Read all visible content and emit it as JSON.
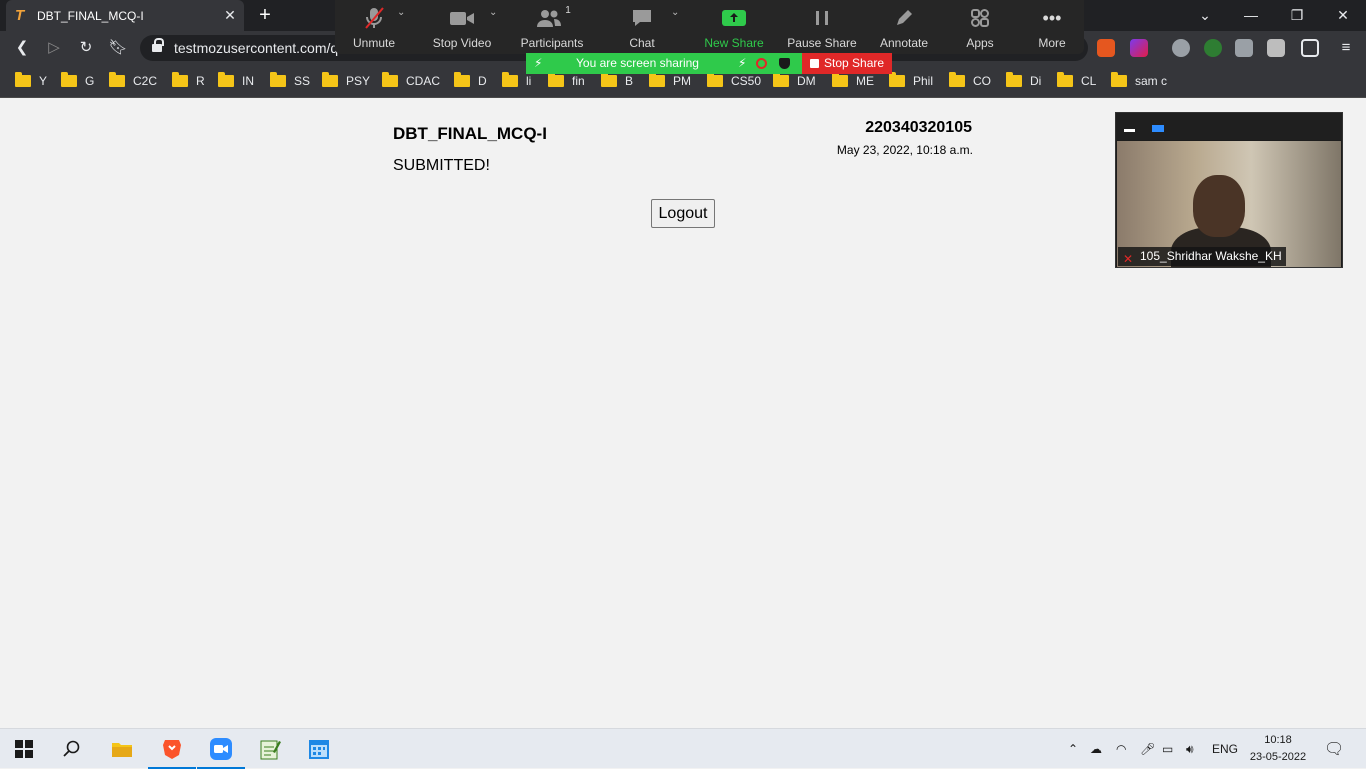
{
  "browser": {
    "tab_title": "DBT_FINAL_MCQ-I",
    "tab_favicon": "T",
    "url": "testmozusercontent.com/q/",
    "bookmarks": [
      "Y",
      "G",
      "C2C",
      "R",
      "IN",
      "SS",
      "PSY",
      "CDAC",
      "D",
      "li",
      "fin",
      "B",
      "PM",
      "CS50",
      "DM",
      "ME",
      "Phil",
      "CO",
      "Di",
      "CL",
      "sam c"
    ]
  },
  "zoom": {
    "unmute": "Unmute",
    "stop_video": "Stop Video",
    "participants": "Participants",
    "participants_count": "1",
    "chat": "Chat",
    "new_share": "New Share",
    "pause_share": "Pause Share",
    "annotate": "Annotate",
    "apps": "Apps",
    "more": "More",
    "sharing_status": "You are screen sharing",
    "stop_share": "Stop Share",
    "participant_name": "105_Shridhar Wakshe_KH"
  },
  "page": {
    "title": "DBT_FINAL_MCQ-I",
    "status": "SUBMITTED!",
    "id": "220340320105",
    "date": "May 23, 2022, 10:18 a.m.",
    "logout": "Logout"
  },
  "taskbar": {
    "lang": "ENG",
    "time": "10:18",
    "date": "23-05-2022"
  },
  "colors": {
    "zoom_green": "#2fca4b",
    "zoom_red": "#e02828",
    "zoom_blue": "#2d8cff"
  }
}
